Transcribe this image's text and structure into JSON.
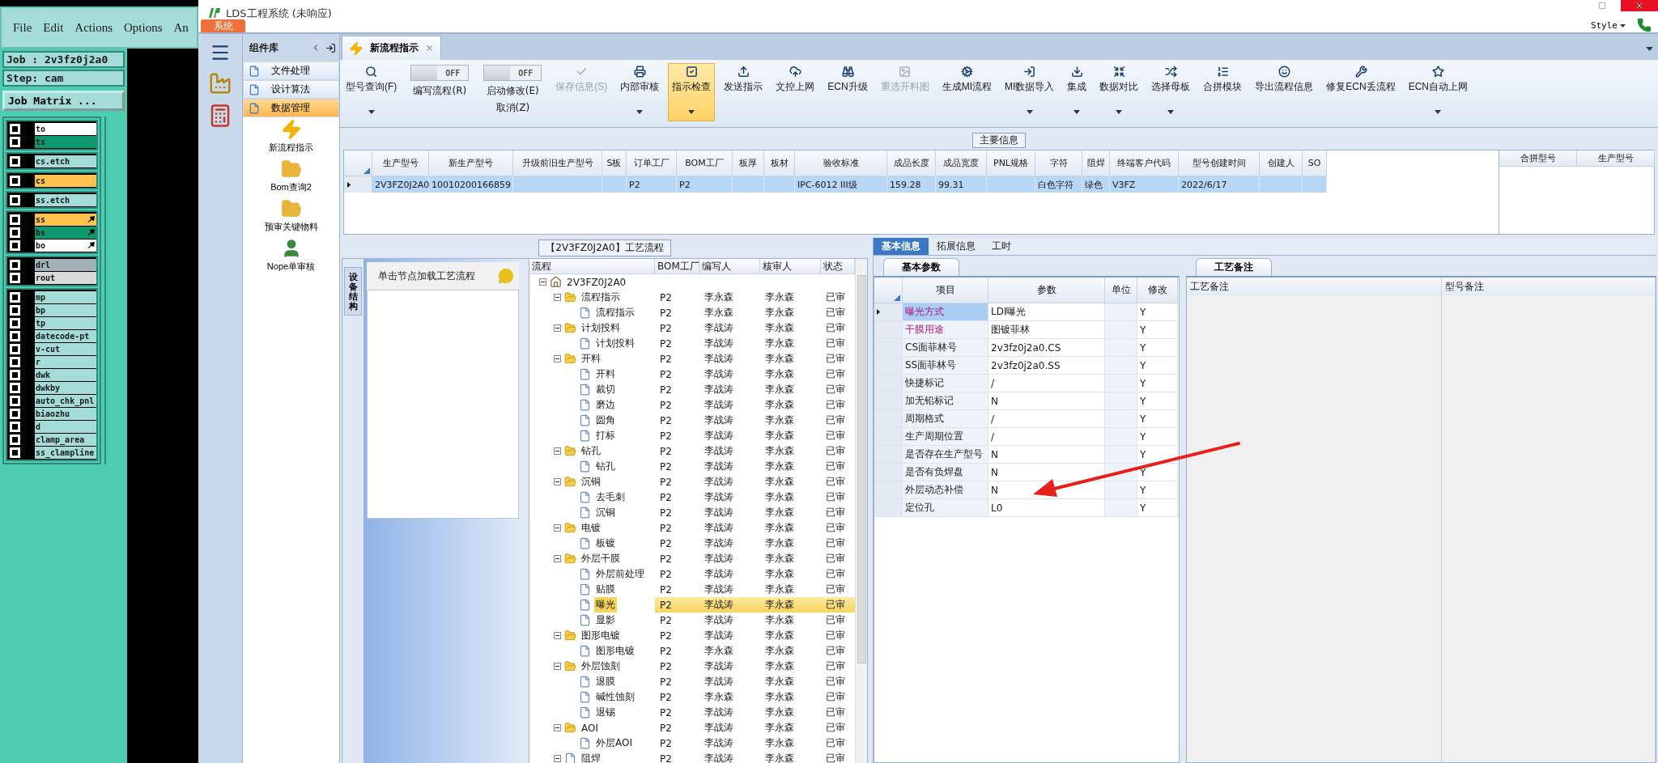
{
  "left_app": {
    "menu": [
      "File",
      "Edit",
      "Actions",
      "Options",
      "An"
    ],
    "job": "Job : 2v3fz0j2a0",
    "step": "Step: cam",
    "matrix_button": "Job Matrix ...",
    "layer_groups": [
      [
        {
          "name": "to",
          "color": "#ffffff",
          "checked": false,
          "flagged": false
        },
        {
          "name": "ts",
          "color": "#0e9a6e",
          "checked": false,
          "flagged": false
        }
      ],
      [
        {
          "name": "cs.etch",
          "color": "#a4dcd8",
          "checked": false,
          "flagged": false
        }
      ],
      [
        {
          "name": "cs",
          "color": "#ffc24d",
          "checked": false,
          "flagged": false
        }
      ],
      [
        {
          "name": "ss.etch",
          "color": "#a4dcd8",
          "checked": false,
          "flagged": false
        }
      ],
      [
        {
          "name": "ss",
          "color": "#ffc24d",
          "checked": false,
          "flagged": true
        },
        {
          "name": "bs",
          "color": "#0e9a6e",
          "checked": false,
          "flagged": true
        },
        {
          "name": "bo",
          "color": "#ffffff",
          "checked": false,
          "flagged": true
        }
      ],
      [
        {
          "name": "drl",
          "color": "#a3b1b8",
          "checked": false,
          "flagged": false
        },
        {
          "name": "rout",
          "color": "#d9d9d9",
          "checked": false,
          "flagged": false
        }
      ],
      [
        {
          "name": "mp",
          "color": "#a4dcd8",
          "checked": false,
          "flagged": false
        },
        {
          "name": "bp",
          "color": "#a4dcd8",
          "checked": false,
          "flagged": false
        },
        {
          "name": "tp",
          "color": "#a4dcd8",
          "checked": false,
          "flagged": false
        },
        {
          "name": "datecode-pt",
          "color": "#a4dcd8",
          "checked": false,
          "flagged": false
        },
        {
          "name": "v-cut",
          "color": "#a4dcd8",
          "checked": false,
          "flagged": false
        },
        {
          "name": "r",
          "color": "#a4dcd8",
          "checked": false,
          "flagged": false
        },
        {
          "name": "dwk",
          "color": "#a4dcd8",
          "checked": false,
          "flagged": false
        },
        {
          "name": "dwkby",
          "color": "#a4dcd8",
          "checked": false,
          "flagged": false
        },
        {
          "name": "auto_chk_pnl",
          "color": "#a4dcd8",
          "checked": false,
          "flagged": false
        },
        {
          "name": "biaozhu",
          "color": "#a4dcd8",
          "checked": false,
          "flagged": false
        },
        {
          "name": "d",
          "color": "#a4dcd8",
          "checked": false,
          "flagged": false
        },
        {
          "name": "clamp_area",
          "color": "#a4dcd8",
          "checked": false,
          "flagged": false
        },
        {
          "name": "ss_clampline",
          "color": "#a4dcd8",
          "checked": false,
          "flagged": false
        }
      ]
    ]
  },
  "window": {
    "title": "LDS工程系统 (未响应)",
    "system_tab": "系统",
    "style_menu": "Style"
  },
  "component_library": {
    "title": "组件库",
    "items": [
      {
        "label": "文件处理",
        "selected": false
      },
      {
        "label": "设计算法",
        "selected": false
      },
      {
        "label": "数据管理",
        "selected": true
      }
    ],
    "launchers": [
      "新流程指示",
      "Bom查询2",
      "预审关键物料",
      "Nope单审核"
    ]
  },
  "document_tab": {
    "label": "新流程指示"
  },
  "toolbar": [
    {
      "kind": "button",
      "label": "型号查询(F)",
      "dropdown": true,
      "disabled": false,
      "selected": false
    },
    {
      "kind": "toggle",
      "label": "编写流程(R)",
      "switch_label": "OFF",
      "on": false
    },
    {
      "kind": "toggle",
      "label": "启动修改(E)",
      "sublabel": "取消(Z)",
      "switch_label": "OFF",
      "on": false
    },
    {
      "kind": "button",
      "label": "保存信息(S)",
      "dropdown": false,
      "disabled": true,
      "selected": false
    },
    {
      "kind": "button",
      "label": "内部审核",
      "dropdown": true,
      "disabled": false,
      "selected": false
    },
    {
      "kind": "button",
      "label": "指示检查",
      "dropdown": true,
      "disabled": false,
      "selected": true
    },
    {
      "kind": "button",
      "label": "发送指示",
      "dropdown": false,
      "disabled": false,
      "selected": false
    },
    {
      "kind": "button",
      "label": "文控上网",
      "dropdown": false,
      "disabled": false,
      "selected": false
    },
    {
      "kind": "button",
      "label": "ECN升级",
      "dropdown": false,
      "disabled": false,
      "selected": false
    },
    {
      "kind": "button",
      "label": "重选开料图",
      "dropdown": false,
      "disabled": true,
      "selected": false
    },
    {
      "kind": "button",
      "label": "生成MI流程",
      "dropdown": false,
      "disabled": false,
      "selected": false
    },
    {
      "kind": "button",
      "label": "MI数据导入",
      "dropdown": true,
      "disabled": false,
      "selected": false
    },
    {
      "kind": "button",
      "label": "集成",
      "dropdown": true,
      "disabled": false,
      "selected": false
    },
    {
      "kind": "button",
      "label": "数据对比",
      "dropdown": true,
      "disabled": false,
      "selected": false
    },
    {
      "kind": "button",
      "label": "选择母板",
      "dropdown": true,
      "disabled": false,
      "selected": false
    },
    {
      "kind": "button",
      "label": "合拼模块",
      "dropdown": false,
      "disabled": false,
      "selected": false
    },
    {
      "kind": "button",
      "label": "导出流程信息",
      "dropdown": false,
      "disabled": false,
      "selected": false
    },
    {
      "kind": "button",
      "label": "修复ECN丢流程",
      "dropdown": false,
      "disabled": false,
      "selected": false
    },
    {
      "kind": "button",
      "label": "ECN自动上网",
      "dropdown": true,
      "disabled": false,
      "selected": false
    }
  ],
  "main_info": {
    "title": "主要信息",
    "columns": [
      "生产型号",
      "新生产型号",
      "升级前旧生产型号",
      "S板",
      "订单工厂",
      "BOM工厂",
      "板厚",
      "板材",
      "验收标准",
      "成品长度",
      "成品宽度",
      "PNL规格",
      "字符",
      "阻焊",
      "终端客户代码",
      "型号创建时间",
      "创建人",
      "SO"
    ],
    "rows": [
      {
        "selected": true,
        "cells": [
          "2V3FZ0J2A0",
          "10010200166859",
          null,
          null,
          "P2",
          "P2",
          null,
          null,
          "IPC-6012 III级",
          "159.28",
          "99.31",
          null,
          "白色字符",
          "绿色",
          "V3FZ",
          "2022/6/17",
          null,
          null
        ]
      }
    ],
    "merge_columns": [
      "合拼型号",
      "生产型号"
    ]
  },
  "process_panel": {
    "title": "【2V3FZ0J2A0】工艺流程",
    "side_tab": "设备结构",
    "hint": "单击节点加载工艺流程",
    "columns": [
      "流程",
      "BOM工厂",
      "编写人",
      "核审人",
      "状态"
    ],
    "tree": [
      {
        "label": "2V3FZ0J2A0",
        "expanded": true,
        "selected": false,
        "children": [
          {
            "label": "流程指示",
            "bom": "P2",
            "writer": "李永森",
            "reviewer": "李永森",
            "status": "已审",
            "expanded": true,
            "selected": false,
            "children": [
              {
                "label": "流程指示",
                "bom": "P2",
                "writer": "李永森",
                "reviewer": "李永森",
                "status": "已审",
                "selected": false
              }
            ]
          },
          {
            "label": "计划投料",
            "bom": "P2",
            "writer": "李战涛",
            "reviewer": "李永森",
            "status": "已审",
            "expanded": true,
            "selected": false,
            "children": [
              {
                "label": "计划投料",
                "bom": "P2",
                "writer": "李战涛",
                "reviewer": "李永森",
                "status": "已审",
                "selected": false
              }
            ]
          },
          {
            "label": "开料",
            "bom": "P2",
            "writer": "李战涛",
            "reviewer": "李永森",
            "status": "已审",
            "expanded": true,
            "selected": false,
            "children": [
              {
                "label": "开料",
                "bom": "P2",
                "writer": "李战涛",
                "reviewer": "李永森",
                "status": "已审",
                "selected": false
              },
              {
                "label": "裁切",
                "bom": "P2",
                "writer": "李战涛",
                "reviewer": "李永森",
                "status": "已审",
                "selected": false
              },
              {
                "label": "磨边",
                "bom": "P2",
                "writer": "李战涛",
                "reviewer": "李永森",
                "status": "已审",
                "selected": false
              },
              {
                "label": "圆角",
                "bom": "P2",
                "writer": "李战涛",
                "reviewer": "李永森",
                "status": "已审",
                "selected": false
              },
              {
                "label": "打标",
                "bom": "P2",
                "writer": "李战涛",
                "reviewer": "李永森",
                "status": "已审",
                "selected": false
              }
            ]
          },
          {
            "label": "钻孔",
            "bom": "P2",
            "writer": "李战涛",
            "reviewer": "李永森",
            "status": "已审",
            "expanded": true,
            "selected": false,
            "children": [
              {
                "label": "钻孔",
                "bom": "P2",
                "writer": "李战涛",
                "reviewer": "李永森",
                "status": "已审",
                "selected": false
              }
            ]
          },
          {
            "label": "沉铜",
            "bom": "P2",
            "writer": "李战涛",
            "reviewer": "李永森",
            "status": "已审",
            "expanded": true,
            "selected": false,
            "children": [
              {
                "label": "去毛刺",
                "bom": "P2",
                "writer": "李战涛",
                "reviewer": "李永森",
                "status": "已审",
                "selected": false
              },
              {
                "label": "沉铜",
                "bom": "P2",
                "writer": "李战涛",
                "reviewer": "李永森",
                "status": "已审",
                "selected": false
              }
            ]
          },
          {
            "label": "电镀",
            "bom": "P2",
            "writer": "李战涛",
            "reviewer": "李永森",
            "status": "已审",
            "expanded": true,
            "selected": false,
            "children": [
              {
                "label": "板镀",
                "bom": "P2",
                "writer": "李战涛",
                "reviewer": "李永森",
                "status": "已审",
                "selected": false
              }
            ]
          },
          {
            "label": "外层干膜",
            "bom": "P2",
            "writer": "李战涛",
            "reviewer": "李永森",
            "status": "已审",
            "expanded": true,
            "selected": false,
            "children": [
              {
                "label": "外层前处理",
                "bom": "P2",
                "writer": "李战涛",
                "reviewer": "李永森",
                "status": "已审",
                "selected": false
              },
              {
                "label": "贴膜",
                "bom": "P2",
                "writer": "李战涛",
                "reviewer": "李永森",
                "status": "已审",
                "selected": false
              },
              {
                "label": "曝光",
                "bom": "P2",
                "writer": "李战涛",
                "reviewer": "李永森",
                "status": "已审",
                "selected": true
              },
              {
                "label": "显影",
                "bom": "P2",
                "writer": "李战涛",
                "reviewer": "李永森",
                "status": "已审",
                "selected": false
              }
            ]
          },
          {
            "label": "图形电镀",
            "bom": "P2",
            "writer": "李战涛",
            "reviewer": "李永森",
            "status": "已审",
            "expanded": true,
            "selected": false,
            "children": [
              {
                "label": "图形电镀",
                "bom": "P2",
                "writer": "李永森",
                "reviewer": "李永森",
                "status": "已审",
                "selected": false
              }
            ]
          },
          {
            "label": "外层蚀刻",
            "bom": "P2",
            "writer": "李战涛",
            "reviewer": "李永森",
            "status": "已审",
            "expanded": true,
            "selected": false,
            "children": [
              {
                "label": "退膜",
                "bom": "P2",
                "writer": "李战涛",
                "reviewer": "李永森",
                "status": "已审",
                "selected": false
              },
              {
                "label": "碱性蚀刻",
                "bom": "P2",
                "writer": "李永森",
                "reviewer": "李永森",
                "status": "已审",
                "selected": false
              },
              {
                "label": "退锡",
                "bom": "P2",
                "writer": "李战涛",
                "reviewer": "李永森",
                "status": "已审",
                "selected": false
              }
            ]
          },
          {
            "label": "AOI",
            "bom": "P2",
            "writer": "李战涛",
            "reviewer": "李永森",
            "status": "已审",
            "expanded": true,
            "selected": false,
            "children": [
              {
                "label": "外层AOI",
                "bom": "P2",
                "writer": "李战涛",
                "reviewer": "李永森",
                "status": "已审",
                "selected": false
              }
            ]
          },
          {
            "label": "阻焊",
            "bom": "P2",
            "writer": "李战涛",
            "reviewer": "李永森",
            "status": "已审",
            "expanded": true,
            "selected": false
          }
        ]
      }
    ]
  },
  "detail_panel": {
    "tabs": [
      {
        "label": "基本信息",
        "selected": true
      },
      {
        "label": "拓展信息",
        "selected": false
      },
      {
        "label": "工时",
        "selected": false
      }
    ],
    "params_tab": "基本参数",
    "columns": [
      "项目",
      "参数",
      "单位",
      "修改"
    ],
    "params": [
      {
        "item": "曝光方式",
        "value": "LDI曝光",
        "modify": "Y",
        "required": true,
        "selected": true
      },
      {
        "item": "干膜用途",
        "value": "图镀菲林",
        "modify": "Y",
        "required": true,
        "selected": false
      },
      {
        "item": "CS面菲林号",
        "value": "2v3fz0j2a0.CS",
        "modify": "Y",
        "required": false,
        "selected": false
      },
      {
        "item": "SS面菲林号",
        "value": "2v3fz0j2a0.SS",
        "modify": "Y",
        "required": false,
        "selected": false
      },
      {
        "item": "快捷标记",
        "value": "/",
        "modify": "Y",
        "required": false,
        "selected": false
      },
      {
        "item": "加无铅标记",
        "value": "N",
        "modify": "Y",
        "required": false,
        "selected": false
      },
      {
        "item": "周期格式",
        "value": "/",
        "modify": "Y",
        "required": false,
        "selected": false
      },
      {
        "item": "生产周期位置",
        "value": "/",
        "modify": "Y",
        "required": false,
        "selected": false
      },
      {
        "item": "是否存在生产型号",
        "value": "N",
        "modify": "Y",
        "required": false,
        "selected": false
      },
      {
        "item": "是否有负焊盘",
        "value": "N",
        "modify": "Y",
        "required": false,
        "selected": false
      },
      {
        "item": "外层动态补偿",
        "value": "N",
        "modify": "Y",
        "required": false,
        "selected": false
      },
      {
        "item": "定位孔",
        "value": "L0",
        "modify": "Y",
        "required": false,
        "selected": false
      }
    ],
    "notes_tab": "工艺备注",
    "notes_columns": [
      "工艺备注",
      "型号备注"
    ]
  }
}
